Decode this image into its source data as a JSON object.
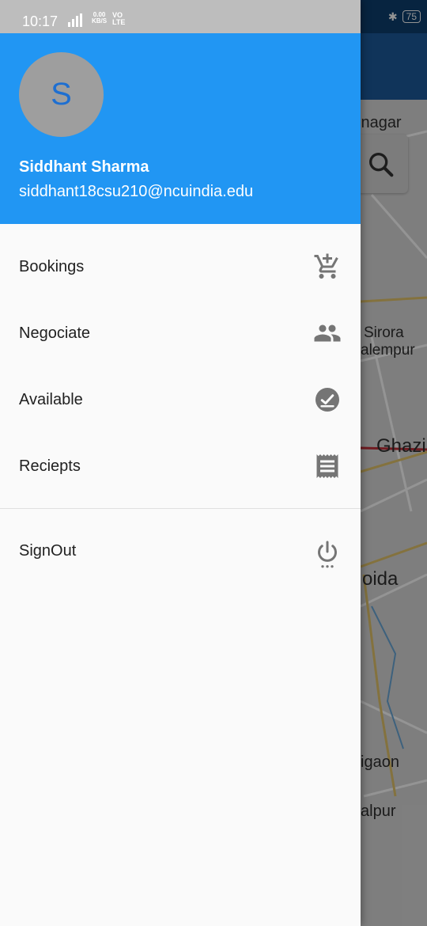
{
  "status_bar": {
    "time": "10:17",
    "network_type": "4G",
    "data_speed": "0.00",
    "data_unit": "KB/S",
    "volte": "VO",
    "lte": "LTE",
    "battery": "75"
  },
  "drawer": {
    "avatar_letter": "S",
    "user_name": "Siddhant Sharma",
    "user_email": "siddhant18csu210@ncuindia.edu",
    "menu": [
      {
        "label": "Bookings",
        "icon": "add-shopping-cart-icon"
      },
      {
        "label": "Negociate",
        "icon": "people-icon"
      },
      {
        "label": "Available",
        "icon": "check-circle-icon"
      },
      {
        "label": "Reciepts",
        "icon": "receipt-icon"
      }
    ],
    "signout_label": "SignOut"
  },
  "map": {
    "labels": [
      "inagar",
      "Sirora",
      "alempur",
      "Ghazi",
      "oida",
      "igaon",
      "alpur"
    ]
  },
  "colors": {
    "header": "#2196f3",
    "drawer_bg": "#fafafa",
    "icon": "#757575"
  }
}
